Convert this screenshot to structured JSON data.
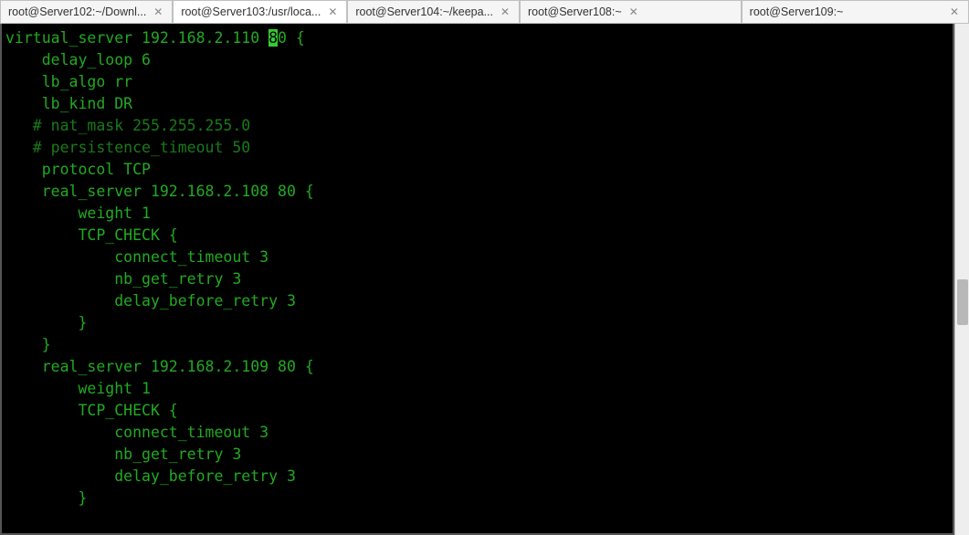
{
  "tabs": [
    {
      "label": "root@Server102:~/Downl...",
      "active": false
    },
    {
      "label": "root@Server103:/usr/loca...",
      "active": true
    },
    {
      "label": "root@Server104:~/keepa...",
      "active": false
    },
    {
      "label": "root@Server108:~",
      "active": false
    },
    {
      "label": "root@Server109:~",
      "active": false
    }
  ],
  "close_glyph": "✕",
  "terminal": {
    "pre_cursor": "virtual_server 192.168.2.110 ",
    "cursor": "8",
    "post_cursor": "0 {",
    "lines": [
      "    delay_loop 6",
      "    lb_algo rr",
      "    lb_kind DR",
      "   # nat_mask 255.255.255.0",
      "   # persistence_timeout 50",
      "    protocol TCP",
      "",
      "    real_server 192.168.2.108 80 {",
      "        weight 1",
      "        TCP_CHECK {",
      "            connect_timeout 3",
      "            nb_get_retry 3",
      "            delay_before_retry 3",
      "        }",
      "    }",
      "    real_server 192.168.2.109 80 {",
      "        weight 1",
      "        TCP_CHECK {",
      "            connect_timeout 3",
      "            nb_get_retry 3",
      "            delay_before_retry 3",
      "        }"
    ]
  }
}
